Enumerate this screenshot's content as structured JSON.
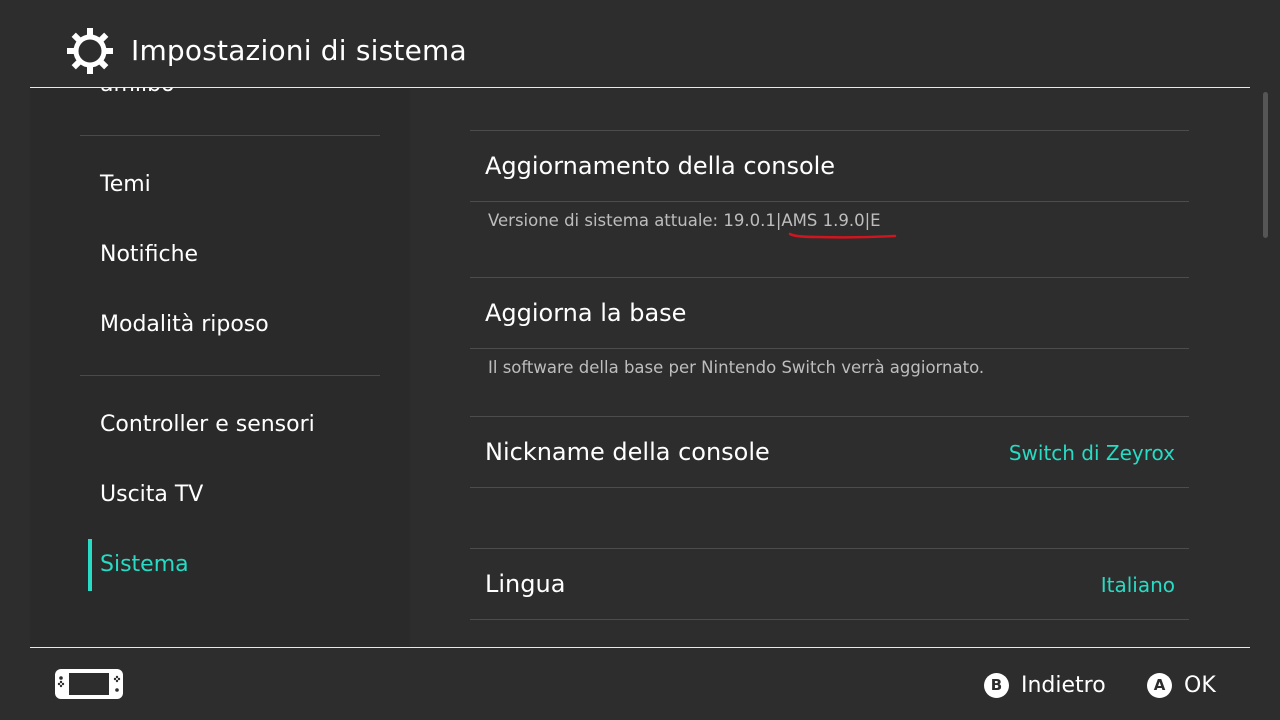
{
  "header": {
    "title": "Impostazioni di sistema",
    "icon": "gear-icon"
  },
  "sidebar": {
    "clipped_item": "amiibo",
    "items": [
      {
        "label": "Temi"
      },
      {
        "label": "Notifiche"
      },
      {
        "label": "Modalità riposo"
      },
      {
        "label": "Controller e sensori"
      },
      {
        "label": "Uscita TV"
      },
      {
        "label": "Sistema",
        "active": true
      }
    ]
  },
  "content": {
    "console_update": {
      "label": "Aggiornamento della console",
      "description": "Versione di sistema attuale: 19.0.1|AMS 1.9.0|E",
      "underline_color": "#d0151f"
    },
    "dock_update": {
      "label": "Aggiorna la base",
      "description": "Il software della base per Nintendo Switch verrà aggiornato."
    },
    "nickname": {
      "label": "Nickname della console",
      "value": "Switch di Zeyrox"
    },
    "language": {
      "label": "Lingua",
      "value": "Italiano"
    }
  },
  "footer": {
    "console_icon": "switch-console-icon",
    "back": {
      "button": "B",
      "label": "Indietro"
    },
    "ok": {
      "button": "A",
      "label": "OK"
    }
  },
  "colors": {
    "accent": "#27dbc4",
    "background": "#2d2d2d",
    "sidebar": "#2a2a2a"
  }
}
